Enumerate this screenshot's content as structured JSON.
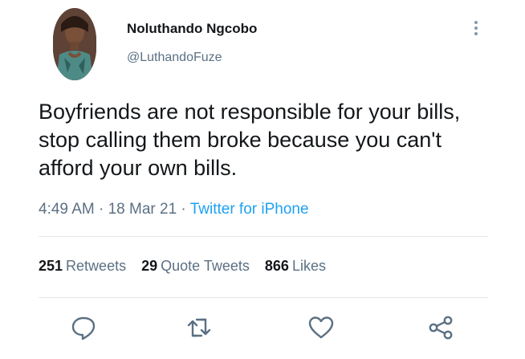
{
  "author": {
    "display_name": "Noluthando Ngcobo",
    "handle": "@LuthandoFuze",
    "avatar_icon": "profile-photo"
  },
  "tweet": {
    "text": "Boyfriends are not responsible for your bills, stop calling them broke because you can't afford your own bills.",
    "time": "4:49 AM",
    "sep1": " · ",
    "date": "18 Mar 21",
    "sep2": " · ",
    "source": "Twitter for iPhone"
  },
  "stats": {
    "retweets_count": "251",
    "retweets_label": "Retweets",
    "quotes_count": "29",
    "quotes_label": "Quote Tweets",
    "likes_count": "866",
    "likes_label": "Likes"
  },
  "actions": {
    "reply_icon": "reply-icon",
    "retweet_icon": "retweet-icon",
    "like_icon": "heart-icon",
    "share_icon": "share-icon"
  },
  "colors": {
    "text": "#14171a",
    "secondary": "#5b7083",
    "link": "#1da1f2",
    "icon": "#5b7083",
    "divider": "#e1e8ed"
  }
}
